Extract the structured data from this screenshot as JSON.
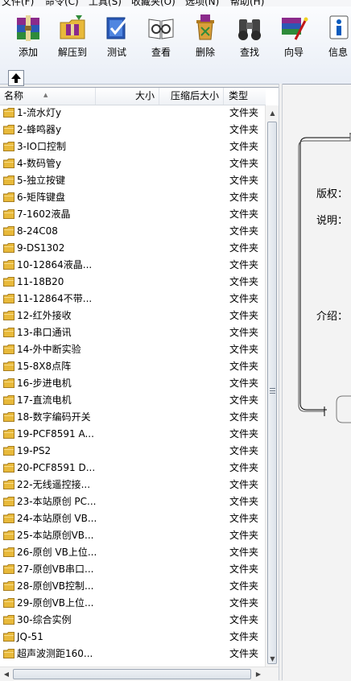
{
  "menubar": {
    "items": [
      "文件(F)",
      "命令(C)",
      "工具(S)",
      "收藏夹(O)",
      "选项(N)",
      "帮助(H)"
    ]
  },
  "toolbar": {
    "buttons": [
      {
        "label": "添加",
        "icon": "rar-books-icon"
      },
      {
        "label": "解压到",
        "icon": "extract-folder-icon"
      },
      {
        "label": "测试",
        "icon": "test-check-icon"
      },
      {
        "label": "查看",
        "icon": "view-book-icon"
      },
      {
        "label": "删除",
        "icon": "delete-bin-icon"
      },
      {
        "label": "查找",
        "icon": "binoculars-icon"
      },
      {
        "label": "向导",
        "icon": "wizard-icon"
      },
      {
        "label": "信息",
        "icon": "info-icon"
      }
    ]
  },
  "filelist": {
    "columns": {
      "name": "名称",
      "size": "大小",
      "packed": "压缩后大小",
      "type": "类型"
    },
    "rows": [
      {
        "name": "1-流水灯y",
        "type": "文件夹"
      },
      {
        "name": "2-蜂鸣器y",
        "type": "文件夹"
      },
      {
        "name": "3-IO口控制",
        "type": "文件夹"
      },
      {
        "name": "4-数码管y",
        "type": "文件夹"
      },
      {
        "name": "5-独立按键",
        "type": "文件夹"
      },
      {
        "name": "6-矩阵键盘",
        "type": "文件夹"
      },
      {
        "name": "7-1602液晶",
        "type": "文件夹"
      },
      {
        "name": "8-24C08",
        "type": "文件夹"
      },
      {
        "name": "9-DS1302",
        "type": "文件夹"
      },
      {
        "name": "10-12864液晶...",
        "type": "文件夹"
      },
      {
        "name": "11-18B20",
        "type": "文件夹"
      },
      {
        "name": "11-12864不带...",
        "type": "文件夹"
      },
      {
        "name": "12-红外接收",
        "type": "文件夹"
      },
      {
        "name": "13-串口通讯",
        "type": "文件夹"
      },
      {
        "name": "14-外中断实验",
        "type": "文件夹"
      },
      {
        "name": "15-8X8点阵",
        "type": "文件夹"
      },
      {
        "name": "16-步进电机",
        "type": "文件夹"
      },
      {
        "name": "17-直流电机",
        "type": "文件夹"
      },
      {
        "name": "18-数字编码开关",
        "type": "文件夹"
      },
      {
        "name": "19-PCF8591 A...",
        "type": "文件夹"
      },
      {
        "name": "19-PS2",
        "type": "文件夹"
      },
      {
        "name": "20-PCF8591 D...",
        "type": "文件夹"
      },
      {
        "name": "22-无线遥控接...",
        "type": "文件夹"
      },
      {
        "name": "23-本站原创 PC...",
        "type": "文件夹"
      },
      {
        "name": "24-本站原创 VB...",
        "type": "文件夹"
      },
      {
        "name": "25-本站原创VB...",
        "type": "文件夹"
      },
      {
        "name": "26-原创 VB上位...",
        "type": "文件夹"
      },
      {
        "name": "27-原创VB串口...",
        "type": "文件夹"
      },
      {
        "name": "28-原创VB控制...",
        "type": "文件夹"
      },
      {
        "name": "29-原创VB上位...",
        "type": "文件夹"
      },
      {
        "name": "30-综合实例",
        "type": "文件夹"
      },
      {
        "name": "JQ-51",
        "type": "文件夹"
      },
      {
        "name": "超声波测距160...",
        "type": "文件夹"
      }
    ]
  },
  "infopanel": {
    "copyright_label": "版权：",
    "description_label": "说明：",
    "intro_label": "介绍："
  },
  "colors": {
    "folder": "#e8b93a",
    "accent": "#0a5bbd"
  }
}
